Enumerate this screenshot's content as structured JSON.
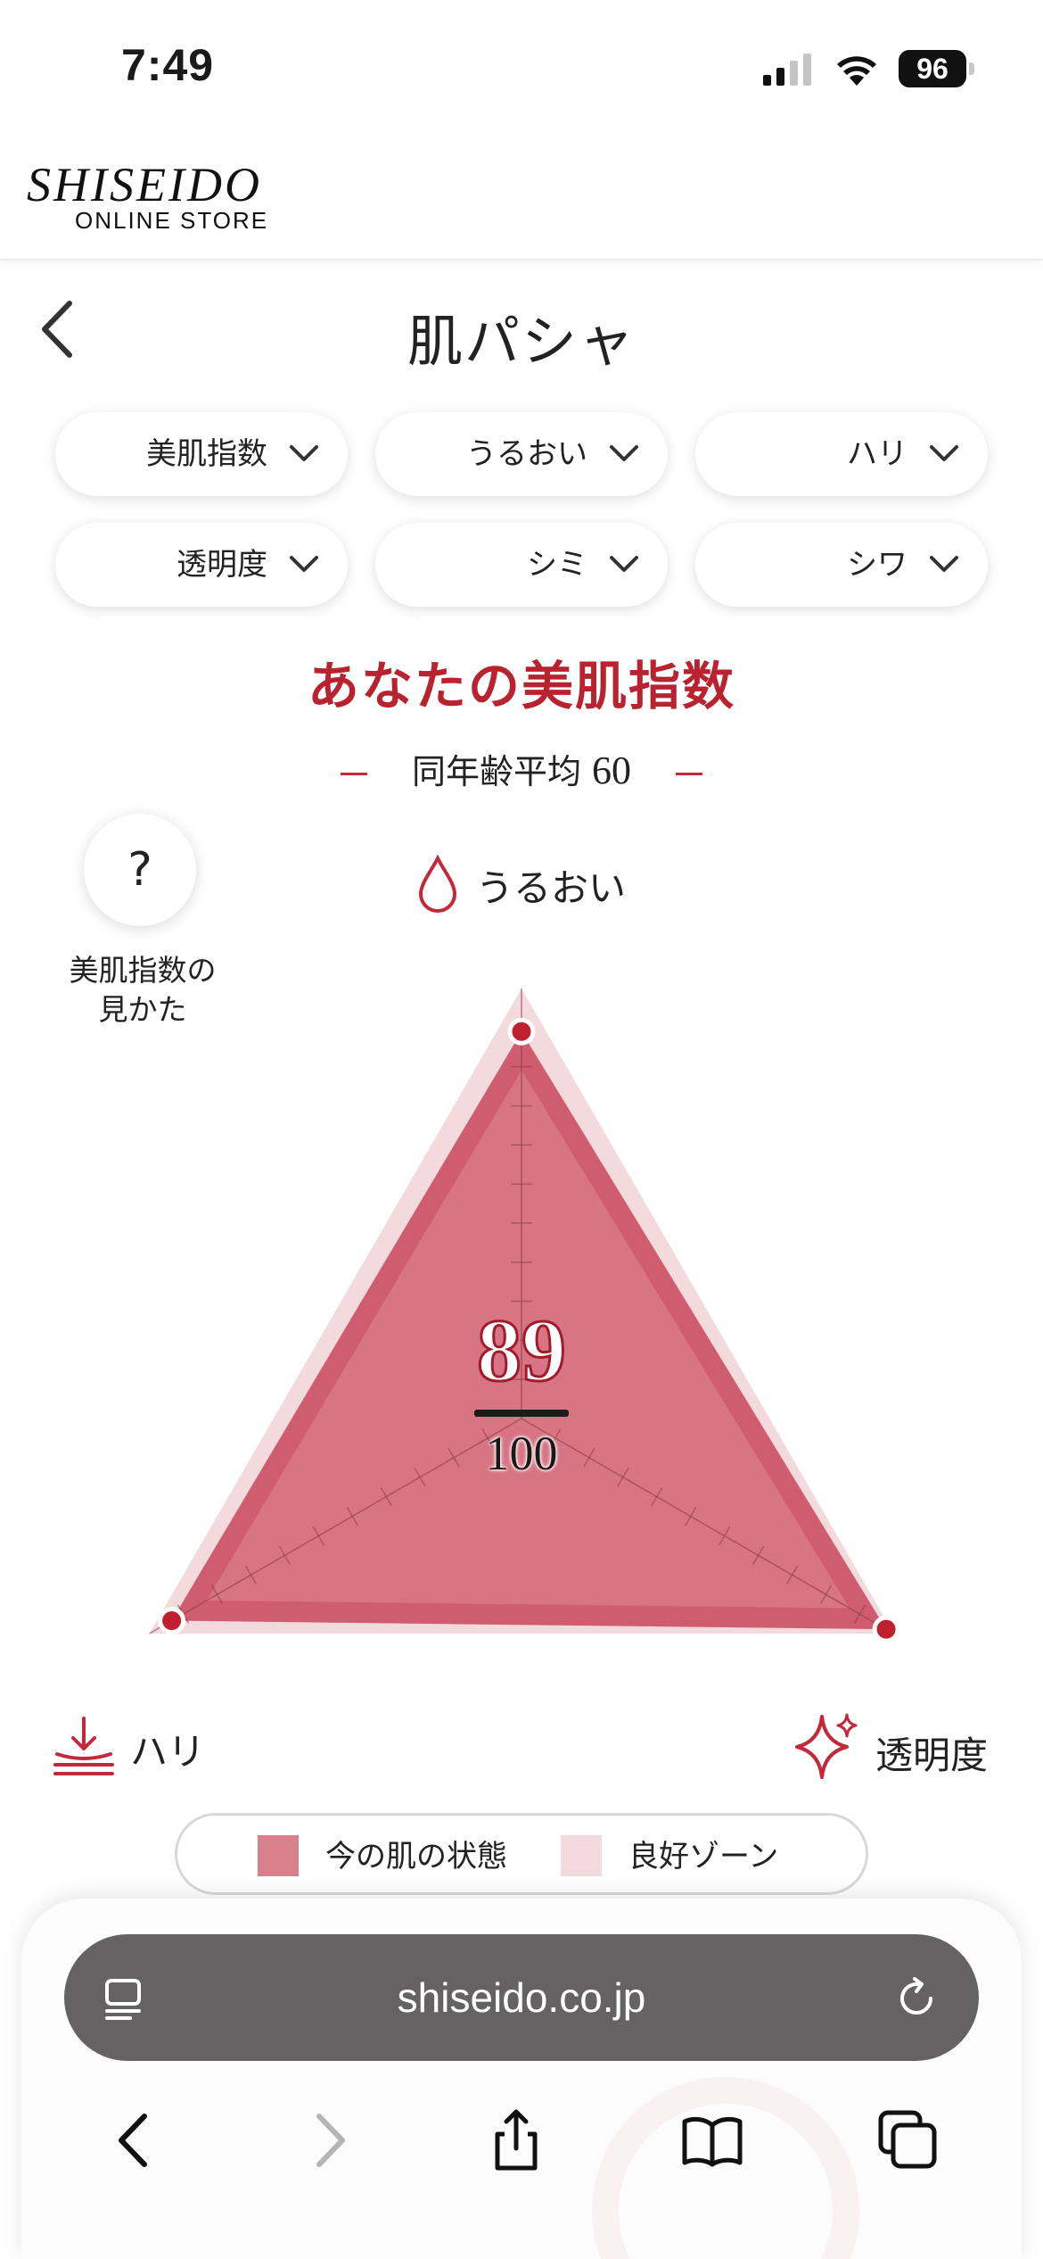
{
  "status_bar": {
    "time": "7:49",
    "battery": "96"
  },
  "header": {
    "logo": "SHISEIDO",
    "logo_sub": "ONLINE STORE"
  },
  "nav": {
    "title": "肌パシャ"
  },
  "filters": [
    {
      "label": "美肌指数"
    },
    {
      "label": "うるおい"
    },
    {
      "label": "ハリ"
    },
    {
      "label": "透明度"
    },
    {
      "label": "シミ"
    },
    {
      "label": "シワ"
    }
  ],
  "score": {
    "title": "あなたの美肌指数",
    "average_label": "同年齢平均",
    "average_value": "60",
    "value": "89",
    "max": "100"
  },
  "help": {
    "icon_label": "?",
    "label_line1": "美肌指数の",
    "label_line2": "見かた"
  },
  "chart_data": {
    "type": "radar",
    "axes": [
      "うるおい",
      "ハリ",
      "透明度"
    ],
    "range": [
      0,
      100
    ],
    "series": [
      {
        "name": "今の肌の状態",
        "values": [
          90,
          94,
          98
        ]
      },
      {
        "name": "良好ゾーン",
        "values": [
          100,
          100,
          100
        ]
      }
    ],
    "colors": {
      "current": "#c9475c",
      "good_zone": "#f2dadd",
      "point": "#bf1f2f"
    }
  },
  "legend": {
    "current": "今の肌の状態",
    "good_zone": "良好ゾーン"
  },
  "browser": {
    "url": "shiseido.co.jp"
  }
}
